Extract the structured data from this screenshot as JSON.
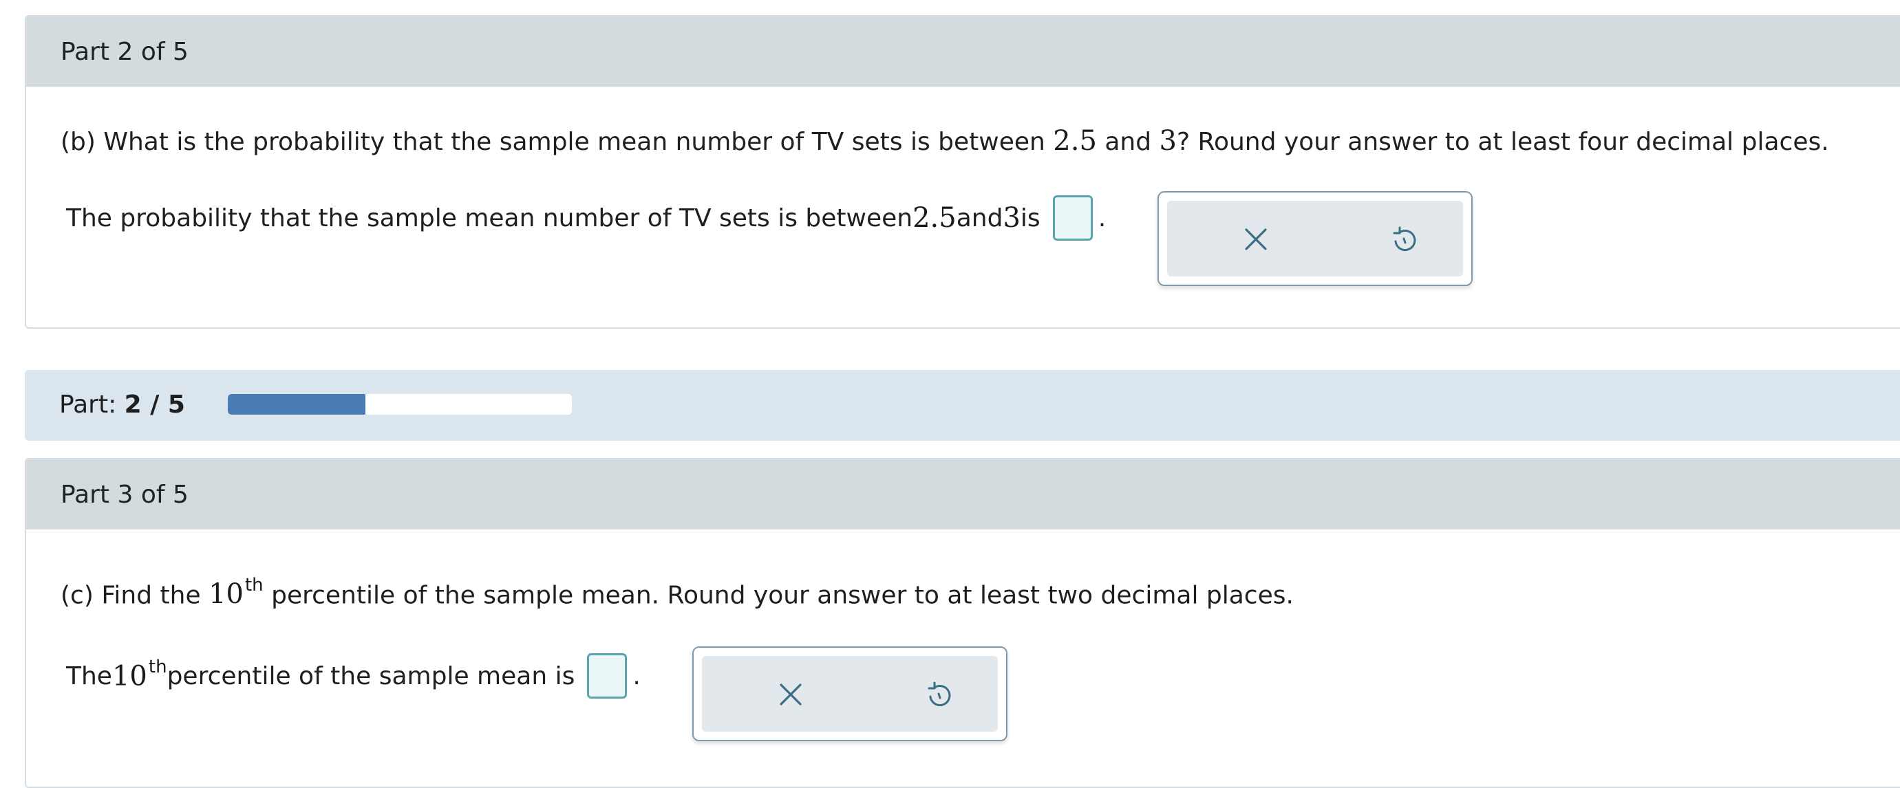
{
  "part2": {
    "header": "Part 2 of 5",
    "question_prefix": "(b) What is the probability that the sample mean number of TV sets is between ",
    "question_num1": "2.5",
    "question_mid": " and ",
    "question_num2": "3",
    "question_suffix": "? Round your answer to at least four decimal places.",
    "answer_prefix": "The probability that the sample mean number of TV sets is between ",
    "answer_num1": "2.5",
    "answer_mid": " and ",
    "answer_num2": "3",
    "answer_suffix": " is",
    "answer_end": "."
  },
  "progress": {
    "label": "Part:",
    "value_text": "2 / 5",
    "fraction": 0.4
  },
  "part3": {
    "header": "Part 3 of 5",
    "question_prefix": "(c) Find the ",
    "question_num": "10",
    "question_sup": "th",
    "question_suffix": " percentile of the sample mean. Round your answer to at least two decimal places.",
    "answer_prefix": "The ",
    "answer_num": "10",
    "answer_sup": "th",
    "answer_suffix": " percentile of the sample mean is",
    "answer_end": "."
  },
  "icons": {
    "clear": "close-icon",
    "undo": "undo-icon"
  },
  "colors": {
    "header_bg": "#d3dbdf",
    "progress_bg": "#dae5ee",
    "progress_fill": "#4a7db6",
    "input_border": "#5aa4ae",
    "icon_color": "#3b6e82"
  }
}
